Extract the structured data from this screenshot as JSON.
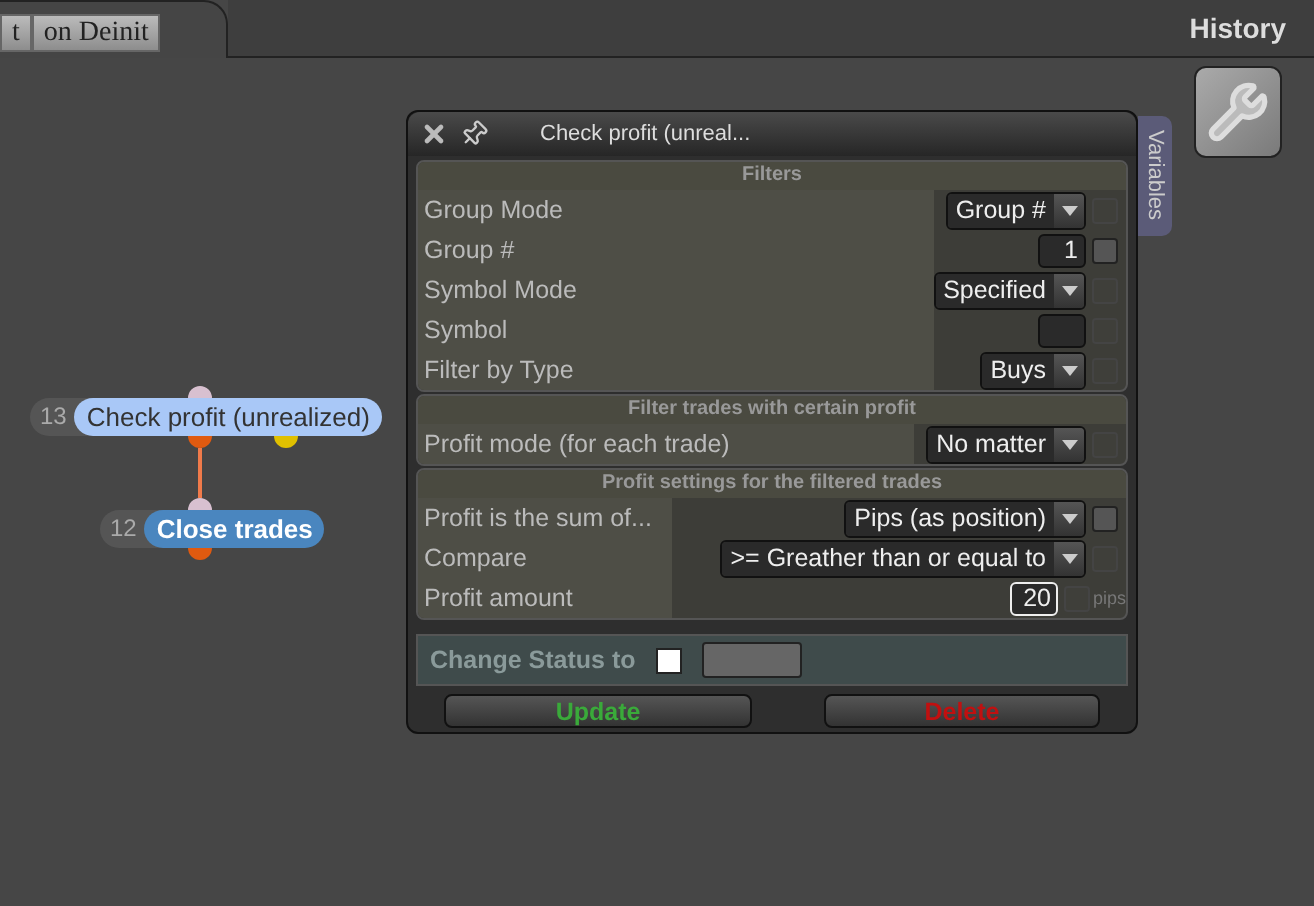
{
  "tabs": [
    {
      "label": "t"
    },
    {
      "label": "on Deinit"
    }
  ],
  "history_label": "History",
  "nodes": [
    {
      "number": "13",
      "label": "Check profit (unrealized)",
      "selected": true,
      "kind": "condition"
    },
    {
      "number": "12",
      "label": "Close trades",
      "selected": false,
      "kind": "action"
    }
  ],
  "dialog": {
    "title": "Check profit (unreal...",
    "side_tab": "Variables",
    "sections": [
      {
        "title": "Filters",
        "rows": [
          {
            "label": "Group Mode",
            "kind": "dropdown",
            "value": "Group #",
            "toggle_enabled": false,
            "checked": false
          },
          {
            "label": "Group #",
            "kind": "input",
            "value": "1",
            "toggle_enabled": true,
            "checked": false
          },
          {
            "label": "Symbol Mode",
            "kind": "dropdown",
            "value": "Specified",
            "toggle_enabled": false,
            "checked": false
          },
          {
            "label": "Symbol",
            "kind": "input",
            "value": "",
            "toggle_enabled": false,
            "checked": false
          },
          {
            "label": "Filter by Type",
            "kind": "dropdown",
            "value": "Buys",
            "toggle_enabled": false,
            "checked": false
          }
        ]
      },
      {
        "title": "Filter trades with certain profit",
        "rows": [
          {
            "label": "Profit mode (for each trade)",
            "kind": "dropdown",
            "value": "No matter",
            "toggle_enabled": false,
            "checked": false
          }
        ]
      },
      {
        "title": "Profit settings for the filtered trades",
        "rows": [
          {
            "label": "Profit is the sum of...",
            "kind": "dropdown",
            "value": "Pips (as position)",
            "toggle_enabled": true,
            "checked": false
          },
          {
            "label": "Compare",
            "kind": "dropdown",
            "value": ">= Greather than or equal to",
            "toggle_enabled": false,
            "checked": false
          },
          {
            "label": "Profit amount",
            "kind": "input",
            "value": "20",
            "focused": true,
            "unit": "pips",
            "toggle_enabled": false,
            "checked": false
          }
        ]
      }
    ],
    "status": {
      "label": "Change Status to",
      "checked": false
    },
    "buttons": [
      {
        "label": "Update",
        "kind": "confirm"
      },
      {
        "label": "Delete",
        "kind": "danger"
      }
    ]
  }
}
